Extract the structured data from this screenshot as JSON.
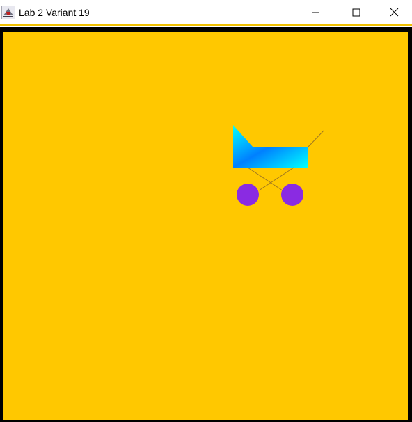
{
  "window": {
    "title": "Lab 2 Variant 19",
    "icon": "java-app-icon",
    "controls": {
      "minimize_icon": "minimize-icon",
      "maximize_icon": "maximize-icon",
      "close_icon": "close-icon"
    }
  },
  "canvas": {
    "background_color": "#ffc800",
    "border_color": "#000000",
    "stroller": {
      "body_gradient_colors": [
        "#00ffff",
        "#0080ff",
        "#00ffff"
      ],
      "wheel_color": "#8a2be2",
      "line_color": "#a07820"
    }
  }
}
